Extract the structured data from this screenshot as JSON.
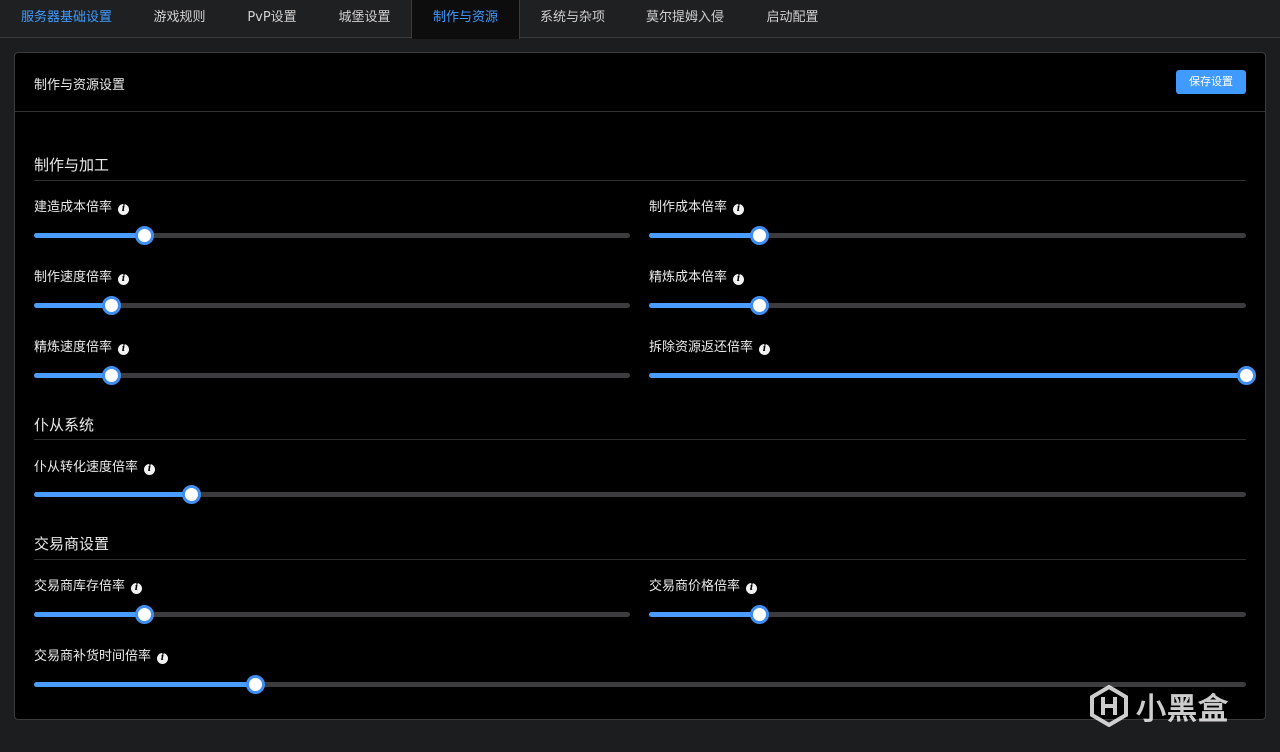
{
  "tabs": [
    {
      "label": "服务器基础设置",
      "state": "highlight"
    },
    {
      "label": "游戏规则",
      "state": "normal"
    },
    {
      "label": "PvP设置",
      "state": "normal"
    },
    {
      "label": "城堡设置",
      "state": "normal"
    },
    {
      "label": "制作与资源",
      "state": "selected"
    },
    {
      "label": "系统与杂项",
      "state": "normal"
    },
    {
      "label": "莫尔提姆入侵",
      "state": "normal"
    },
    {
      "label": "启动配置",
      "state": "normal"
    }
  ],
  "panel": {
    "title": "制作与资源设置",
    "save_label": "保存设置"
  },
  "sections": [
    {
      "title": "制作与加工",
      "fields": [
        {
          "label": "建造成本倍率",
          "fill": 0.185
        },
        {
          "label": "制作成本倍率",
          "fill": 0.185
        },
        {
          "label": "制作速度倍率",
          "fill": 0.13
        },
        {
          "label": "精炼成本倍率",
          "fill": 0.185
        },
        {
          "label": "精炼速度倍率",
          "fill": 0.13
        },
        {
          "label": "拆除资源返还倍率",
          "fill": 1.0
        }
      ]
    },
    {
      "title": "仆从系统",
      "fields": [
        {
          "label": "仆从转化速度倍率",
          "fill": 0.13
        }
      ]
    },
    {
      "title": "交易商设置",
      "fields": [
        {
          "label": "交易商库存倍率",
          "fill": 0.185
        },
        {
          "label": "交易商价格倍率",
          "fill": 0.185
        },
        {
          "label": "交易商补货时间倍率",
          "fill": 0.183
        }
      ]
    }
  ],
  "info_icon_glyph": "i",
  "watermark": {
    "text": "小黑盒"
  },
  "colors": {
    "accent": "#3f9bff",
    "background": "#000000",
    "track": "#3c3c3e"
  }
}
